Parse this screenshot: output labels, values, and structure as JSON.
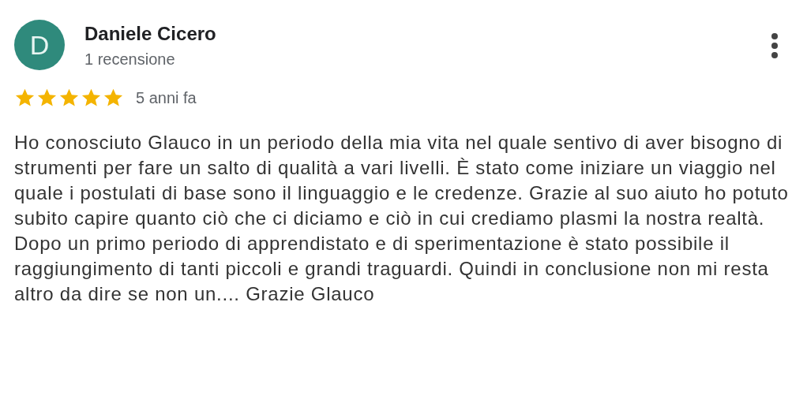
{
  "reviewer": {
    "initial": "D",
    "name": "Daniele Cicero",
    "review_count": "1 recensione"
  },
  "review": {
    "stars": 5,
    "time": "5 anni fa",
    "text": "Ho conosciuto Glauco in un periodo della mia vita nel quale sentivo di aver bisogno di strumenti per fare un salto di qualità a vari livelli. È stato come iniziare un viaggio nel quale i postulati di base sono il linguaggio e le credenze. Grazie al suo aiuto ho potuto subito capire quanto ciò che ci diciamo e ciò in cui crediamo plasmi la nostra realtà. Dopo un primo periodo di apprendistato e di sperimentazione è stato possibile il raggiungimento di tanti piccoli e grandi traguardi. Quindi in conclusione non mi resta altro da dire se non un.... Grazie Glauco"
  }
}
